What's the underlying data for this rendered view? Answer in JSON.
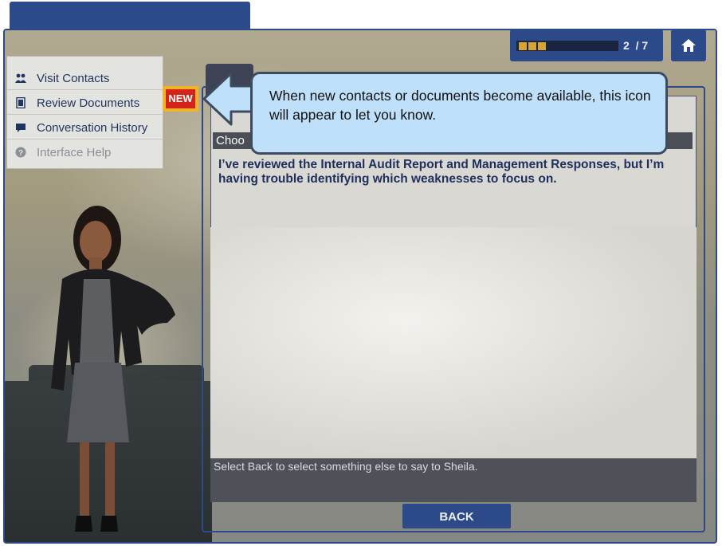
{
  "progress": {
    "current": "2",
    "total": "/ 7",
    "filled_segments": 3,
    "total_segments": 7
  },
  "menu": {
    "items": [
      {
        "label": "Visit Contacts",
        "icon": "people-icon",
        "enabled": true
      },
      {
        "label": "Review Documents",
        "icon": "document-icon",
        "enabled": true
      },
      {
        "label": "Conversation History",
        "icon": "chat-icon",
        "enabled": true
      },
      {
        "label": "Interface Help",
        "icon": "help-icon",
        "enabled": false
      }
    ]
  },
  "badge": {
    "label": "NEW"
  },
  "callout": {
    "text": "When new contacts or documents become available, this icon will appear to let you know."
  },
  "panel": {
    "choose_label": "Choo",
    "question": "I’ve reviewed the Internal Audit Report and Management Responses, but I’m having trouble identifying which weaknesses to focus on.",
    "status": "Select Back to select something else to say to Sheila."
  },
  "back_button": {
    "label": "BACK"
  },
  "colors": {
    "accent": "#2c4a8a",
    "badge_red": "#d4231b",
    "badge_gold": "#f0b329",
    "callout": "#bfe0fb"
  }
}
